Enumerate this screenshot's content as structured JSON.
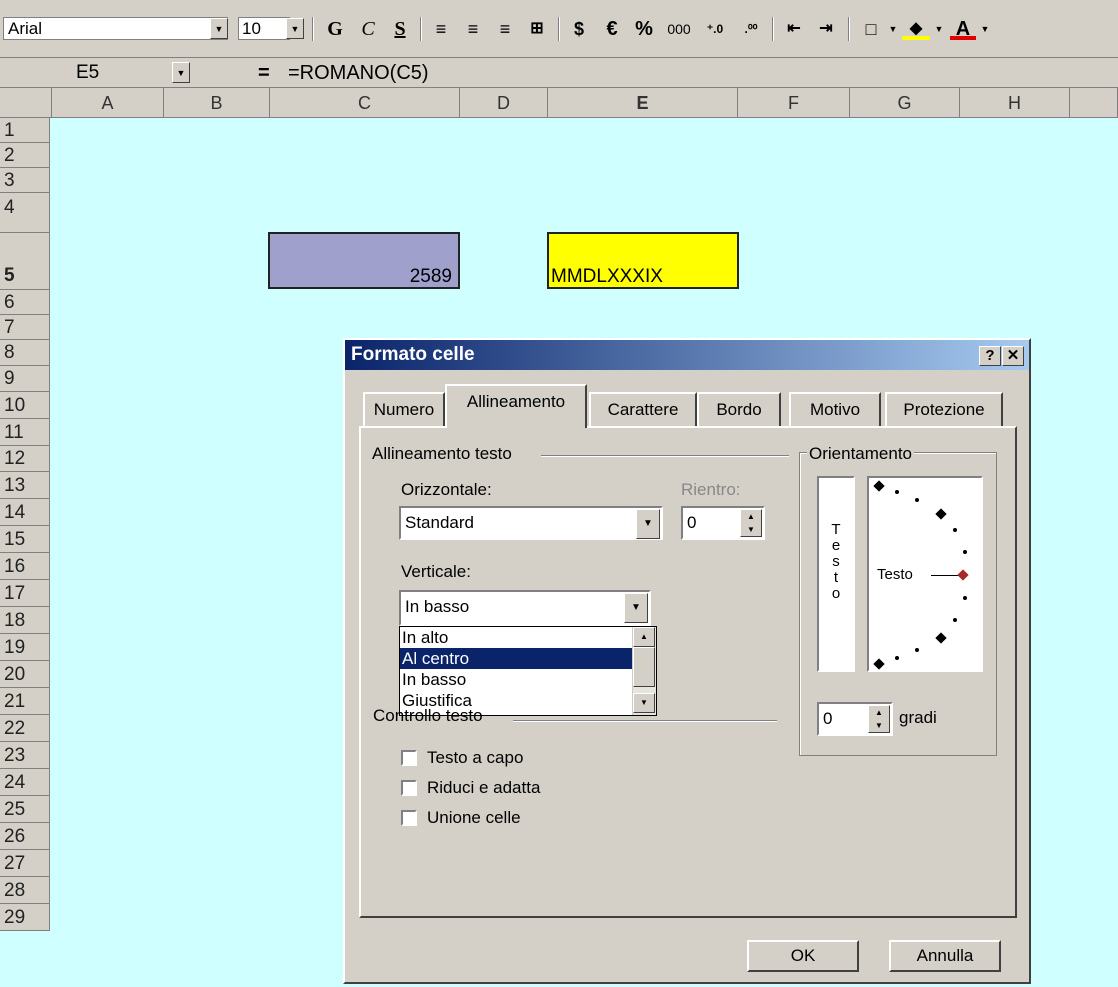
{
  "toolbar": {
    "font_name": "Arial",
    "font_size": "10",
    "bold": "G",
    "italic": "C",
    "underline": "S",
    "euro": "€",
    "percent": "%",
    "thousands": "000"
  },
  "formula_bar": {
    "name_box": "E5",
    "equals": "=",
    "formula": "=ROMANO(C5)"
  },
  "columns": [
    "A",
    "B",
    "C",
    "D",
    "E",
    "F",
    "G",
    "H"
  ],
  "rows": [
    "1",
    "2",
    "3",
    "4",
    "5",
    "6",
    "7",
    "8",
    "9",
    "10",
    "11",
    "12",
    "13",
    "14",
    "15",
    "16",
    "17",
    "18",
    "19",
    "20",
    "21",
    "22",
    "23",
    "24",
    "25",
    "26",
    "27",
    "28",
    "29"
  ],
  "cells": {
    "c5": "2589",
    "e5": "MMDLXXXIX"
  },
  "dialog": {
    "title": "Formato celle",
    "help": "?",
    "close": "✕",
    "tabs": [
      "Numero",
      "Allineamento",
      "Carattere",
      "Bordo",
      "Motivo",
      "Protezione"
    ],
    "text_alignment_group": "Allineamento testo",
    "horizontal_label": "Orizzontale:",
    "horizontal_value": "Standard",
    "indent_label": "Rientro:",
    "indent_value": "0",
    "vertical_label": "Verticale:",
    "vertical_value": "In basso",
    "vertical_options": [
      "In alto",
      "Al centro",
      "In basso",
      "Giustifica"
    ],
    "text_control_group": "Controllo testo",
    "wrap_text": "Testo a capo",
    "shrink_to_fit": "Riduci e adatta",
    "merge_cells": "Unione celle",
    "orientation_group": "Orientamento",
    "vertical_text_letters": [
      "T",
      "e",
      "s",
      "t",
      "o"
    ],
    "orientation_text": "Testo",
    "degrees_value": "0",
    "degrees_label": "gradi",
    "ok": "OK",
    "cancel": "Annulla"
  }
}
